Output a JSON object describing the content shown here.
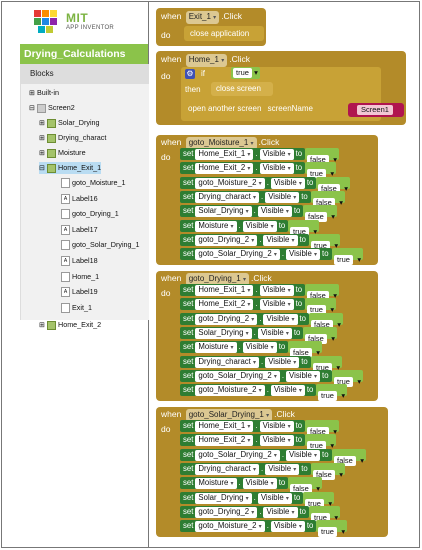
{
  "app": {
    "logo_title": "MIT",
    "logo_subtitle": "APP INVENTOR",
    "project_name": "Drying_Calculations",
    "blocks_header": "Blocks",
    "brand_colors": {
      "green": "#8bc34a",
      "event": "#b38b29",
      "set": "#2e7d32"
    }
  },
  "tree": {
    "builtin": "Built-in",
    "screen": "Screen2",
    "items": [
      "Solar_Drying",
      "Drying_charact",
      "Moisture",
      "Home_Exit_1"
    ],
    "children": [
      "goto_Moisture_1",
      "Label16",
      "goto_Drying_1",
      "Label17",
      "goto_Solar_Drying_1",
      "Label18",
      "Home_1",
      "Label19",
      "Exit_1"
    ],
    "last": "Home_Exit_2"
  },
  "blocks": {
    "when": "when",
    "do": "do",
    "click": ".Click",
    "set": "set",
    "to": "to",
    "dot": ".",
    "visible": "Visible",
    "exit_event": {
      "component": "Exit_1",
      "action": "close application"
    },
    "home_event": {
      "component": "Home_1",
      "if": "if",
      "cond": "true",
      "then": "then",
      "then_action": "close screen",
      "open": "open another screen",
      "screenName": "screenName",
      "screen_value": "Screen1"
    },
    "moisture_event": {
      "component": "goto_Moisture_1",
      "rows": [
        {
          "comp": "Home_Exit_1",
          "val": "false"
        },
        {
          "comp": "Home_Exit_2",
          "val": "true"
        },
        {
          "comp": "goto_Moisture_2",
          "val": "false"
        },
        {
          "comp": "Drying_charact",
          "val": "false"
        },
        {
          "comp": "Solar_Drying",
          "val": "false"
        },
        {
          "comp": "Moisture",
          "val": "true"
        },
        {
          "comp": "goto_Drying_2",
          "val": "true"
        },
        {
          "comp": "goto_Solar_Drying_2",
          "val": "true"
        }
      ]
    },
    "drying_event": {
      "component": "goto_Drying_1",
      "rows": [
        {
          "comp": "Home_Exit_1",
          "val": "false"
        },
        {
          "comp": "Home_Exit_2",
          "val": "true"
        },
        {
          "comp": "goto_Drying_2",
          "val": "false"
        },
        {
          "comp": "Solar_Drying",
          "val": "false"
        },
        {
          "comp": "Moisture",
          "val": "false"
        },
        {
          "comp": "Drying_charact",
          "val": "true"
        },
        {
          "comp": "goto_Solar_Drying_2",
          "val": "true"
        },
        {
          "comp": "goto_Moisture_2",
          "val": "true"
        }
      ]
    },
    "solar_event": {
      "component": "goto_Solar_Drying_1",
      "rows": [
        {
          "comp": "Home_Exit_1",
          "val": "false"
        },
        {
          "comp": "Home_Exit_2",
          "val": "true"
        },
        {
          "comp": "goto_Solar_Drying_2",
          "val": "false"
        },
        {
          "comp": "Drying_charact",
          "val": "false"
        },
        {
          "comp": "Moisture",
          "val": "false"
        },
        {
          "comp": "Solar_Drying",
          "val": "true"
        },
        {
          "comp": "goto_Drying_2",
          "val": "true"
        },
        {
          "comp": "goto_Moisture_2",
          "val": "true"
        }
      ]
    }
  }
}
